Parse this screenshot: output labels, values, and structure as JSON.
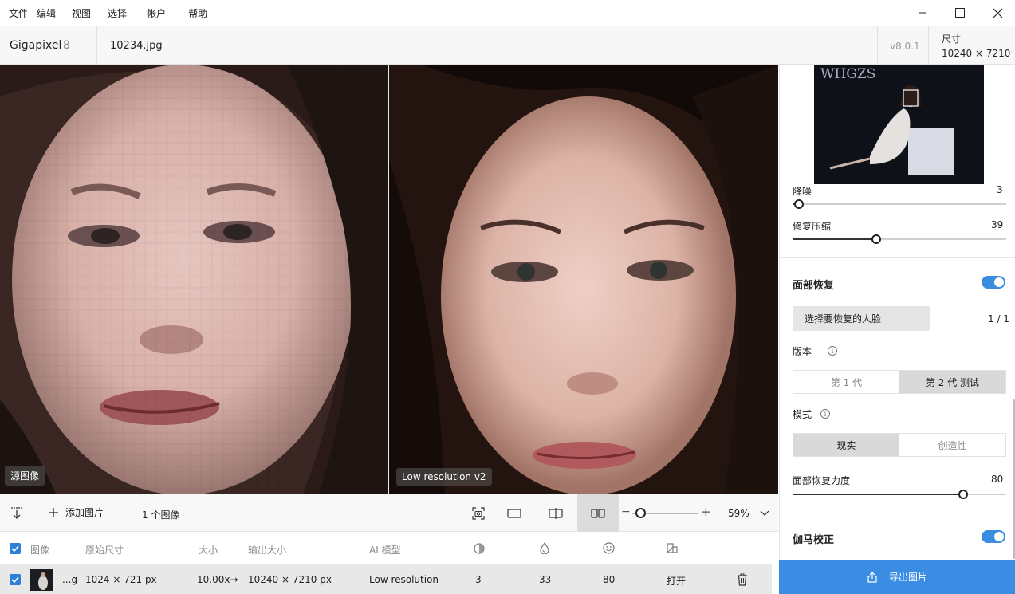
{
  "menu": {
    "items": [
      "文件",
      "编辑",
      "视图",
      "选择",
      "帐户",
      "帮助"
    ]
  },
  "window": {
    "minimize": "minimize-icon",
    "maximize": "maximize-icon",
    "close": "close-icon"
  },
  "header": {
    "app_name": "Gigapixel",
    "app_version": "8",
    "file_name": "10234.jpg",
    "build_version": "v8.0.1",
    "size_label": "尺寸",
    "size_value": "10240 × 7210"
  },
  "preview": {
    "left_label": "源图像",
    "right_label": "Low resolution v2"
  },
  "toolbar": {
    "add_image": "添加图片",
    "image_count": "1 个图像",
    "zoom_minus": "−",
    "zoom_plus": "+",
    "zoom_value": "59%",
    "zoom_level": 0.12
  },
  "table": {
    "headers": [
      "图像",
      "原始尺寸",
      "大小",
      "输出大小",
      "AI 模型"
    ],
    "row": {
      "name": "...g",
      "original_size": "1024 × 721 px",
      "scale": "10.00x→",
      "output_size": "10240 × 7210 px",
      "model": "Low resolution",
      "noise": "3",
      "compression": "33",
      "face": "80",
      "action": "打开"
    }
  },
  "side": {
    "thumb_text": "WHGZS",
    "denoise_label": "降噪",
    "denoise_value": "3",
    "denoise_level": 0.03,
    "compress_label": "修复压缩",
    "compress_value": "39",
    "compress_level": 0.39,
    "face_title": "面部恢复",
    "face_select": "选择要恢复的人脸",
    "face_count": "1 / 1",
    "version_label": "版本",
    "version_opts": [
      "第 1 代",
      "第 2 代   测试"
    ],
    "mode_label": "模式",
    "mode_opts": [
      "现实",
      "创造性"
    ],
    "strength_label": "面部恢复力度",
    "strength_value": "80",
    "strength_level": 0.8,
    "gamma_title": "伽马校正",
    "export": "导出图片"
  },
  "colors": {
    "accent": "#3a8de2",
    "toggle": "#3b8de0"
  }
}
